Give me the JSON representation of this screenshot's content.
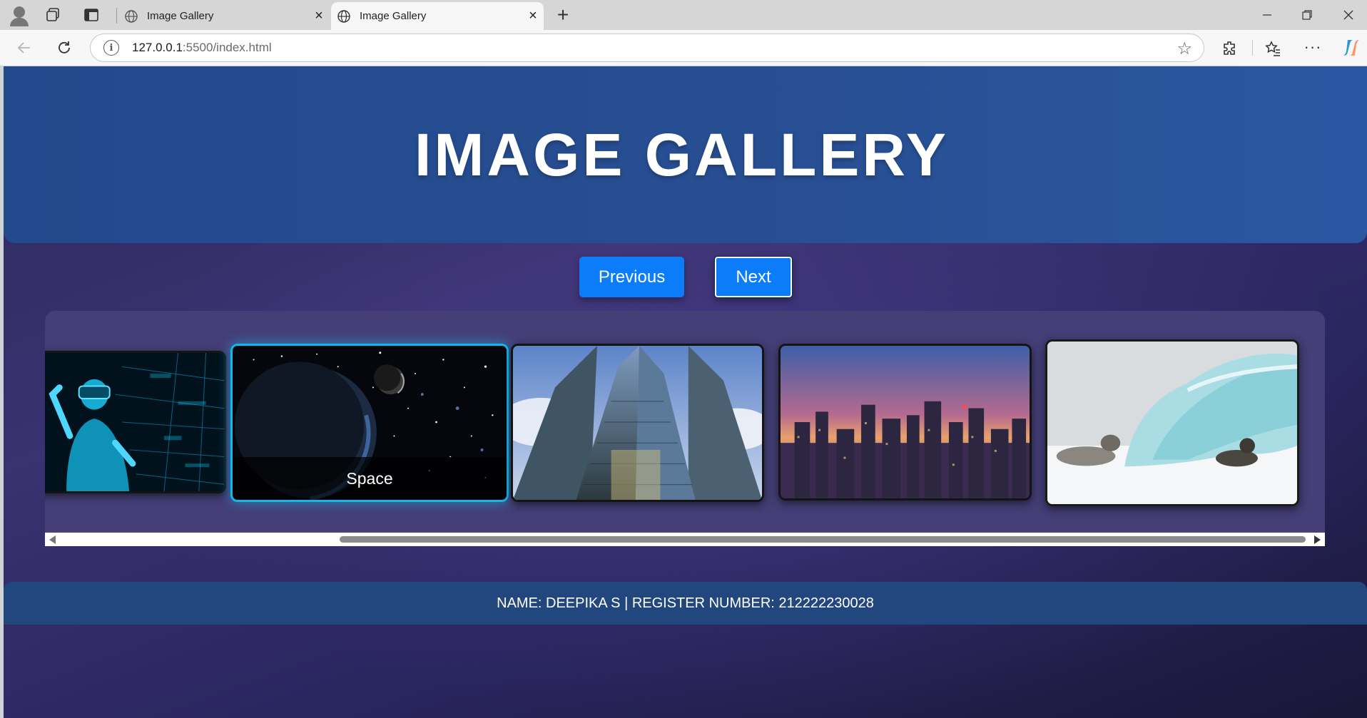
{
  "browser": {
    "tabs": [
      {
        "title": "Image Gallery",
        "active": false
      },
      {
        "title": "Image Gallery",
        "active": true
      }
    ],
    "url_host": "127.0.0.1",
    "url_path": ":5500/index.html",
    "icons": {
      "profile": "profile-icon",
      "workspaces": "workspaces-icon",
      "vertical_tabs": "vertical-tabs-icon",
      "globe": "globe-icon",
      "close": "close-icon",
      "new_tab": "plus-icon",
      "back": "back-arrow-icon",
      "reload": "reload-icon",
      "info": "info-icon",
      "favorite": "star-icon",
      "extensions": "puzzle-icon",
      "favorites": "favorites-icon",
      "more": "more-icon",
      "copilot": "copilot-icon"
    }
  },
  "page": {
    "title": "IMAGE GALLERY",
    "buttons": {
      "previous": "Previous",
      "next": "Next"
    },
    "gallery": {
      "images": [
        {
          "subject": "virtual reality",
          "caption": ""
        },
        {
          "subject": "space",
          "caption": "Space",
          "active": true
        },
        {
          "subject": "skyscrapers",
          "caption": ""
        },
        {
          "subject": "city skyline at dusk",
          "caption": ""
        },
        {
          "subject": "seals by iceberg",
          "caption": ""
        }
      ]
    },
    "footer": "NAME: DEEPIKA S | REGISTER NUMBER: 212222230028"
  },
  "colors": {
    "header_bg": "#284f93",
    "button_bg": "#0b7dfb",
    "active_border": "#11b8ec",
    "footer_bg": "#22477f",
    "page_bg": "#2c2a5c"
  }
}
